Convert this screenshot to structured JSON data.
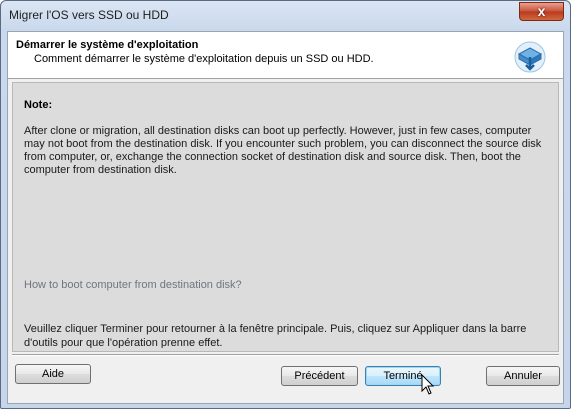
{
  "window": {
    "title": "Migrer l'OS vers SSD ou HDD",
    "close_glyph": "x"
  },
  "header": {
    "title": "Démarrer le système d'exploitation",
    "subtitle": "Comment démarrer le système d'exploitation depuis un SSD ou HDD.",
    "icon": "disk-migrate-icon"
  },
  "content": {
    "note_label": "Note:",
    "note_text": "After clone or migration, all destination disks can boot up perfectly. However, just in few cases, computer may not boot from the destination disk. If you encounter such problem, you can disconnect the source disk from computer, or, exchange the connection socket of destination disk and source disk. Then, boot the computer from destination disk.",
    "howto_link": "How to boot computer from destination disk?",
    "instructions": "Veuillez cliquer Terminer pour retourner à la fenêtre principale. Puis, cliquez sur Appliquer dans la barre d'outils pour que l'opération prenne effet."
  },
  "buttons": {
    "help": "Aide",
    "previous": "Précédent",
    "finish": "Terminé",
    "cancel": "Annuler"
  },
  "colors": {
    "title_close": "#c75139",
    "link_gray": "#6e7680",
    "default_button": "#3c7fb1"
  }
}
